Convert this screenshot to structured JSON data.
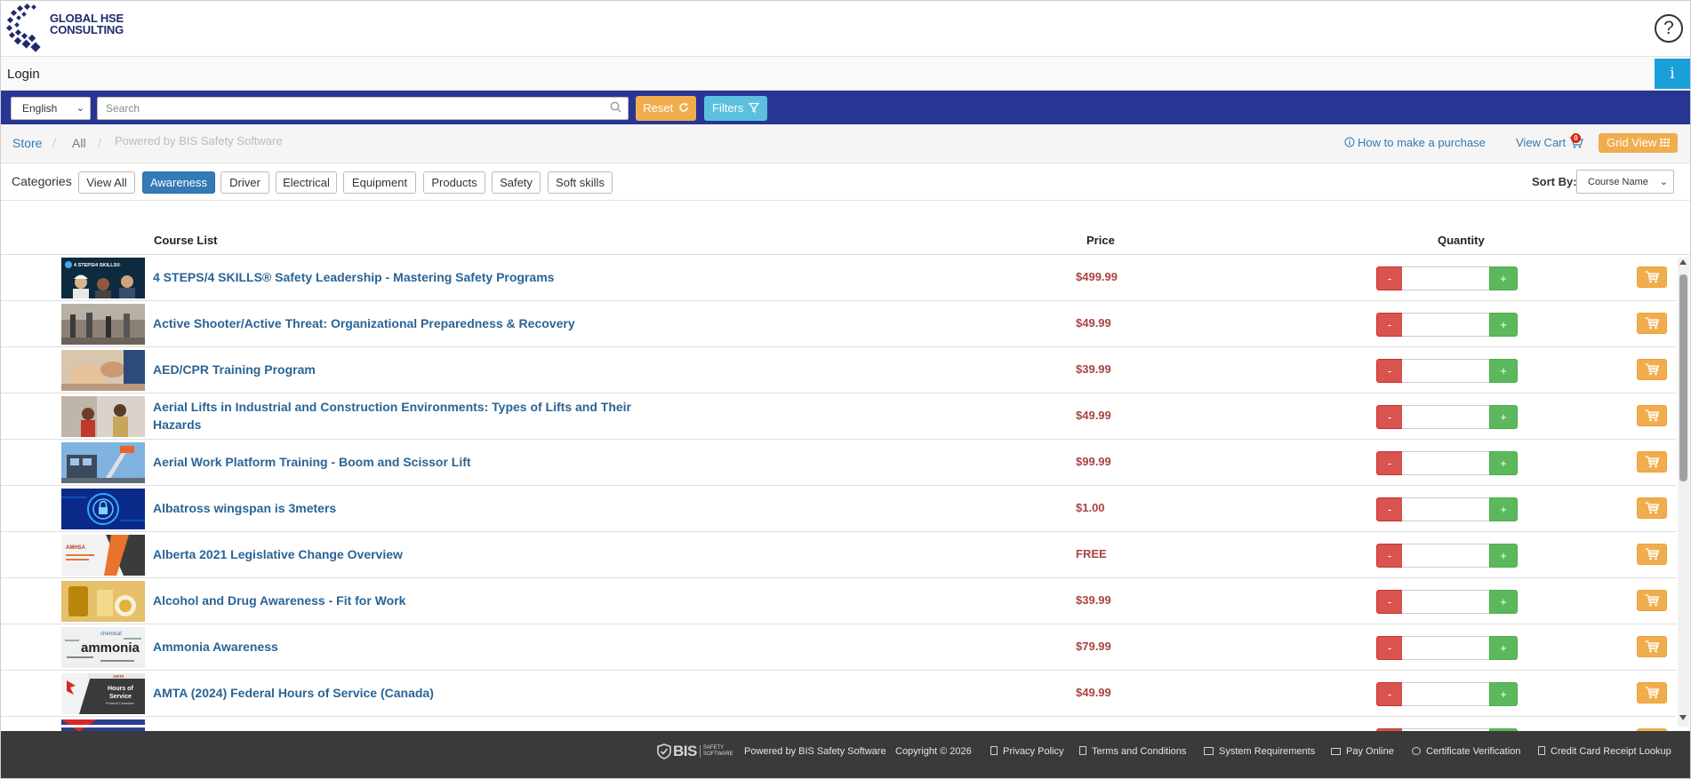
{
  "header": {
    "logo_line1": "GLOBAL HSE",
    "logo_line2": "CONSULTING",
    "help_symbol": "?"
  },
  "login_bar": {
    "login_label": "Login",
    "info_symbol": "i"
  },
  "search_bar": {
    "language": "English",
    "search_placeholder": "Search",
    "reset_label": "Reset",
    "filters_label": "Filters"
  },
  "breadcrumb": {
    "store": "Store",
    "separator": "/",
    "all": "All",
    "powered": "Powered by BIS Safety Software",
    "how_to_purchase": "How to make a purchase",
    "view_cart": "View Cart",
    "cart_count": "0",
    "grid_view": "Grid View"
  },
  "categories": {
    "label": "Categories",
    "items": [
      "View All",
      "Awareness",
      "Driver",
      "Electrical",
      "Equipment",
      "Products",
      "Safety",
      "Soft skills"
    ],
    "active": "Awareness",
    "sort_label": "Sort By:",
    "sort_value": "Course Name"
  },
  "table": {
    "col_course": "Course List",
    "col_price": "Price",
    "col_quantity": "Quantity",
    "minus_label": "-",
    "plus_label": "+",
    "rows": [
      {
        "title": "4 STEPS/4 SKILLS® Safety Leadership - Mastering Safety Programs",
        "price": "$499.99",
        "thumb": "leadership"
      },
      {
        "title": "Active Shooter/Active Threat: Organizational Preparedness & Recovery",
        "price": "$49.99",
        "thumb": "office"
      },
      {
        "title": "AED/CPR Training Program",
        "price": "$39.99",
        "thumb": "cpr"
      },
      {
        "title": "Aerial Lifts in Industrial and Construction Environments: Types of Lifts and Their Hazards",
        "price": "$49.99",
        "thumb": "meeting"
      },
      {
        "title": "Aerial Work Platform Training - Boom and Scissor Lift",
        "price": "$99.99",
        "thumb": "lift"
      },
      {
        "title": "Albatross wingspan is 3meters",
        "price": "$1.00",
        "thumb": "digital"
      },
      {
        "title": "Alberta 2021 Legislative Change Overview",
        "price": "FREE",
        "thumb": "alberta"
      },
      {
        "title": "Alcohol and Drug Awareness - Fit for Work",
        "price": "$39.99",
        "thumb": "alcohol"
      },
      {
        "title": "Ammonia Awareness",
        "price": "$79.99",
        "thumb": "ammonia"
      },
      {
        "title": "AMTA (2024) Federal Hours of Service (Canada)",
        "price": "$49.99",
        "thumb": "hours"
      }
    ],
    "thumb_texts": {
      "leadership": "4 STEPS/4 SKILLS®",
      "alberta": "AMHSA",
      "ammonia_big": "ammonia",
      "ammonia_small": "chemical",
      "hours_brand": "AMTA",
      "hours_line1": "Hours of",
      "hours_line2": "Service",
      "hours_line3": "Federal Canadian"
    }
  },
  "footer": {
    "bis_word": "BIS",
    "bis_sub1": "SAFETY",
    "bis_sub2": "SOFTWARE",
    "powered": "Powered by BIS Safety Software",
    "copyright": "Copyright © 2026",
    "privacy": "Privacy Policy",
    "terms": "Terms and Conditions",
    "requirements": "System Requirements",
    "pay_online": "Pay Online",
    "certificate": "Certificate Verification",
    "receipt": "Credit Card Receipt Lookup"
  },
  "colors": {
    "nav_blue": "#283593",
    "link_blue": "#2a6496",
    "price_red": "#a94442",
    "warning_orange": "#f0ad4e",
    "info_cyan": "#5bc0de",
    "danger_red": "#d9534f",
    "success_green": "#5cb85c",
    "footer_dark": "#3a3a3a"
  }
}
